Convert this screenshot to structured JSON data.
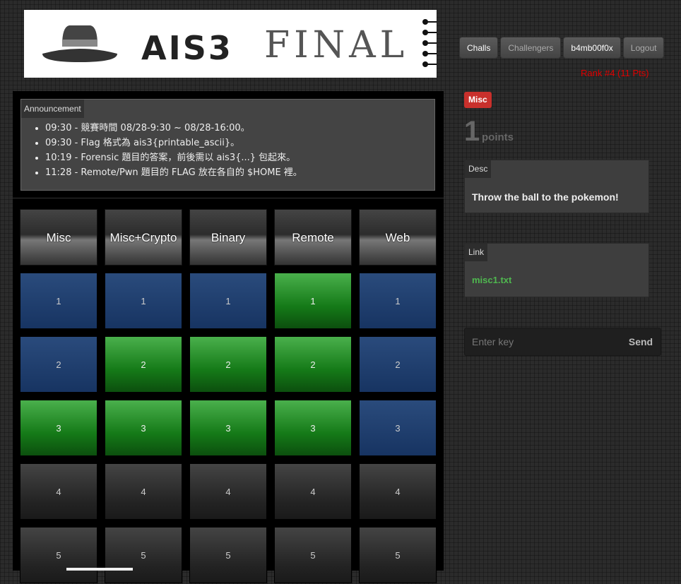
{
  "banner": {
    "brand": "AIS3",
    "final": "FINAL"
  },
  "nav": {
    "challs": "Challs",
    "challengers": "Challengers",
    "user": "b4mb00f0x",
    "logout": "Logout"
  },
  "rank": "Rank #4 (11 Pts)",
  "announcement": {
    "title": "Announcement",
    "items": [
      "09:30 - 競賽時間 08/28-9:30 ~ 08/28-16:00。",
      "09:30 - Flag 格式為 ais3{printable_ascii}。",
      "10:19 - Forensic 題目的答案，前後需以 ais3{...} 包起來。",
      "11:28 - Remote/Pwn 題目的 FLAG 放在各自的 $HOME 裡。"
    ]
  },
  "categories": [
    "Misc",
    "Misc+Crypto",
    "Binary",
    "Remote",
    "Web"
  ],
  "grid": [
    [
      {
        "label": "1",
        "status": "blue"
      },
      {
        "label": "1",
        "status": "blue"
      },
      {
        "label": "1",
        "status": "blue"
      },
      {
        "label": "1",
        "status": "green"
      },
      {
        "label": "1",
        "status": "blue"
      }
    ],
    [
      {
        "label": "2",
        "status": "blue"
      },
      {
        "label": "2",
        "status": "green"
      },
      {
        "label": "2",
        "status": "green"
      },
      {
        "label": "2",
        "status": "green"
      },
      {
        "label": "2",
        "status": "blue"
      }
    ],
    [
      {
        "label": "3",
        "status": "green"
      },
      {
        "label": "3",
        "status": "green"
      },
      {
        "label": "3",
        "status": "green"
      },
      {
        "label": "3",
        "status": "green"
      },
      {
        "label": "3",
        "status": "blue"
      }
    ],
    [
      {
        "label": "4",
        "status": "gray"
      },
      {
        "label": "4",
        "status": "gray"
      },
      {
        "label": "4",
        "status": "gray"
      },
      {
        "label": "4",
        "status": "gray"
      },
      {
        "label": "4",
        "status": "gray"
      }
    ],
    [
      {
        "label": "5",
        "status": "gray"
      },
      {
        "label": "5",
        "status": "gray"
      },
      {
        "label": "5",
        "status": "gray"
      },
      {
        "label": "5",
        "status": "gray"
      },
      {
        "label": "5",
        "status": "gray"
      }
    ]
  ],
  "challenge": {
    "category": "Misc",
    "points": "1",
    "points_label": "points",
    "desc_title": "Desc",
    "desc": "Throw the ball to the pokemon!",
    "link_title": "Link",
    "link": "misc1.txt"
  },
  "key_form": {
    "placeholder": "Enter key",
    "send": "Send"
  },
  "colors": {
    "blue": "#1f3d6e",
    "green": "#2b9a2e",
    "gray": "#2a2a2a",
    "rank": "#e00000",
    "badge": "#c9302c",
    "link": "#4fb84f"
  }
}
